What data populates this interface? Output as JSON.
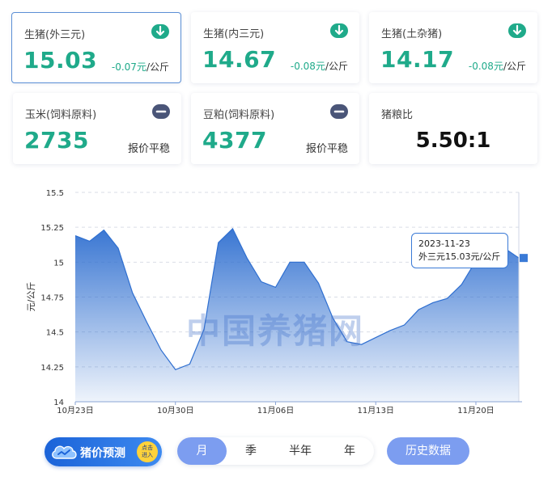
{
  "cards": [
    {
      "name": "生猪(外三元)",
      "value": "15.03",
      "change": "-0.07元",
      "unit": "/公斤",
      "trend": "down-arrow-icon"
    },
    {
      "name": "生猪(内三元)",
      "value": "14.67",
      "change": "-0.08元",
      "unit": "/公斤",
      "trend": "down-arrow-icon"
    },
    {
      "name": "生猪(土杂猪)",
      "value": "14.17",
      "change": "-0.08元",
      "unit": "/公斤",
      "trend": "down-arrow-icon"
    },
    {
      "name": "玉米(饲料原料)",
      "value": "2735",
      "status": "报价平稳",
      "trend": "flat-icon"
    },
    {
      "name": "豆粕(饲料原料)",
      "value": "4377",
      "status": "报价平稳",
      "trend": "flat-icon"
    },
    {
      "name": "猪粮比",
      "value": "5.50:1"
    }
  ],
  "colors": {
    "up_down_green": "#1faa8a",
    "flat_badge": "#4a5578",
    "accent_blue": "#7c9df0",
    "area_blue": "#3a7ad6"
  },
  "chart_data": {
    "type": "area",
    "ylabel": "元/公斤",
    "ylim": [
      14,
      15.5
    ],
    "yticks": [
      "15.5",
      "15.25",
      "15",
      "14.75",
      "14.5",
      "14.25",
      "14"
    ],
    "xtick_labels": [
      "10月23日",
      "10月30日",
      "11月06日",
      "11月13日",
      "11月20日"
    ],
    "x": [
      "2023-10-23",
      "2023-10-24",
      "2023-10-25",
      "2023-10-26",
      "2023-10-27",
      "2023-10-28",
      "2023-10-29",
      "2023-10-30",
      "2023-10-31",
      "2023-11-01",
      "2023-11-02",
      "2023-11-03",
      "2023-11-04",
      "2023-11-05",
      "2023-11-06",
      "2023-11-07",
      "2023-11-08",
      "2023-11-09",
      "2023-11-10",
      "2023-11-11",
      "2023-11-12",
      "2023-11-13",
      "2023-11-14",
      "2023-11-15",
      "2023-11-16",
      "2023-11-17",
      "2023-11-18",
      "2023-11-19",
      "2023-11-20",
      "2023-11-21",
      "2023-11-22",
      "2023-11-23"
    ],
    "series": [
      {
        "values": [
          15.19,
          15.15,
          15.23,
          15.1,
          14.78,
          14.57,
          14.37,
          14.23,
          14.27,
          14.52,
          15.14,
          15.24,
          15.03,
          14.86,
          14.82,
          15.0,
          15.0,
          14.85,
          14.6,
          14.43,
          14.41,
          14.46,
          14.51,
          14.55,
          14.66,
          14.71,
          14.74,
          14.84,
          15.01,
          15.12,
          15.1,
          15.03
        ]
      }
    ],
    "grid": true
  },
  "tooltip": {
    "date": "2023-11-23",
    "text": "外三元15.03元/公斤"
  },
  "watermark": "中国养猪网",
  "forecast": {
    "label": "猪价预测",
    "badge_line1": "点击",
    "badge_line2": "进入"
  },
  "periods": [
    "月",
    "季",
    "半年",
    "年"
  ],
  "selected_period": "月",
  "history_label": "历史数据"
}
